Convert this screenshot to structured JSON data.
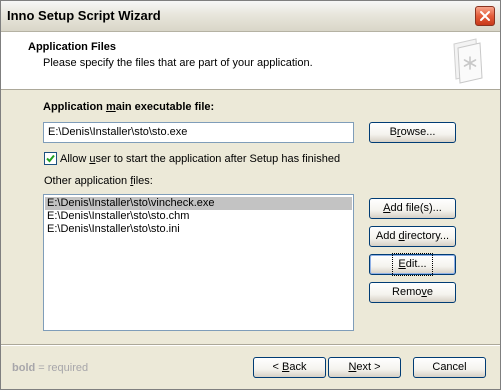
{
  "window": {
    "title": "Inno Setup Script Wizard"
  },
  "header": {
    "title": "Application Files",
    "subtitle": "Please specify the files that are part of your application."
  },
  "main_exe": {
    "label_pre": "Application ",
    "label_ul": "m",
    "label_post": "ain executable file:",
    "value": "E:\\Denis\\Installer\\sto\\sto.exe",
    "browse_pre": "B",
    "browse_ul": "r",
    "browse_post": "owse..."
  },
  "allow_start": {
    "checked": true,
    "label_pre": "Allow ",
    "label_ul": "u",
    "label_post": "ser to start the application after Setup has finished"
  },
  "other_files": {
    "label_pre": "Other application ",
    "label_ul": "f",
    "label_post": "iles:",
    "items": [
      "E:\\Denis\\Installer\\sto\\vincheck.exe",
      "E:\\Denis\\Installer\\sto\\sto.chm",
      "E:\\Denis\\Installer\\sto\\sto.ini"
    ],
    "selected_index": 0
  },
  "buttons": {
    "add_files": {
      "pre": "",
      "ul": "A",
      "post": "dd file(s)..."
    },
    "add_directory": {
      "pre": "Add ",
      "ul": "d",
      "post": "irectory..."
    },
    "edit": {
      "pre": "",
      "ul": "E",
      "post": "dit..."
    },
    "remove": {
      "pre": "Remo",
      "ul": "v",
      "post": "e"
    },
    "back": {
      "pre": "< ",
      "ul": "B",
      "post": "ack"
    },
    "next": {
      "pre": "",
      "ul": "N",
      "post": "ext >"
    },
    "cancel": {
      "label": "Cancel"
    }
  },
  "footer": {
    "bold_word": "bold",
    "rest": " = required"
  },
  "colors": {
    "selection": "#c3c3c3",
    "close_button": "#e35d3a",
    "footer_text": "#a7a6aa"
  }
}
